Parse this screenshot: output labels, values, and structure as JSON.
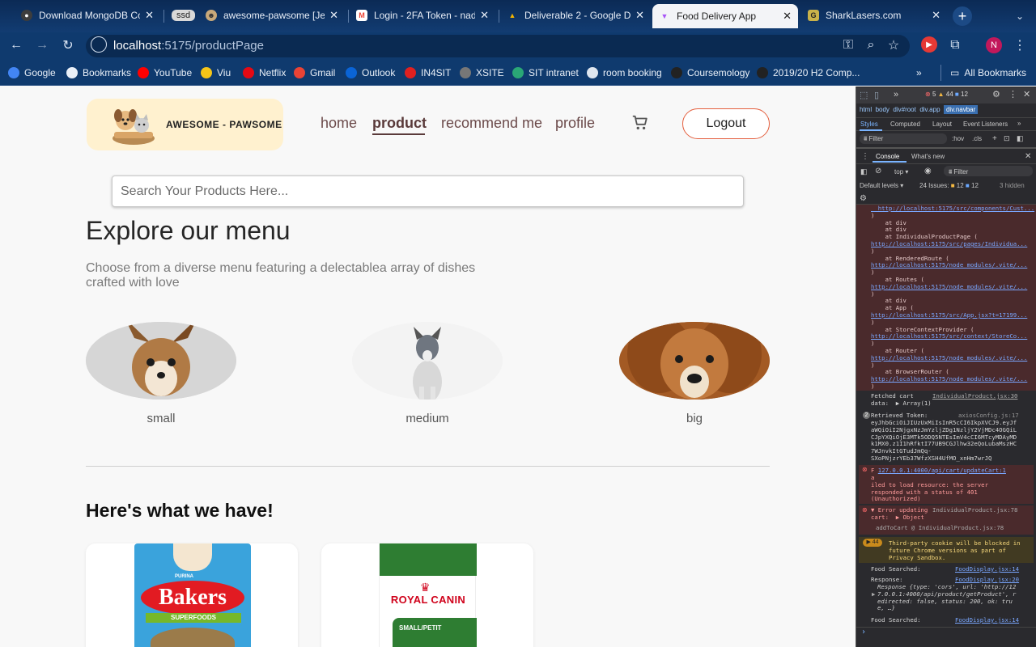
{
  "browser": {
    "tabs": [
      {
        "title": "Download MongoDB Co",
        "icon": "mongodb-icon"
      },
      {
        "title": "ssd",
        "icon": "group-icon"
      },
      {
        "title": "awesome-pawsome [Jer",
        "icon": "github-icon"
      },
      {
        "title": "Login - 2FA Token - nadi",
        "icon": "gmail-icon"
      },
      {
        "title": "Deliverable 2 - Google D",
        "icon": "drive-icon"
      },
      {
        "title": "Food Delivery App",
        "icon": "vite-icon"
      },
      {
        "title": "SharkLasers.com",
        "icon": "sharklasers-icon"
      }
    ],
    "url_host": "localhost",
    "url_path": ":5175/productPage",
    "profile_initial": "N",
    "bookmarks": [
      {
        "label": "Google",
        "icon": "google-icon",
        "color": "#4285f4"
      },
      {
        "label": "Bookmarks",
        "icon": "star-icon",
        "color": "#eaf0f8"
      },
      {
        "label": "YouTube",
        "icon": "youtube-icon",
        "color": "#ff0000"
      },
      {
        "label": "Viu",
        "icon": "viu-icon",
        "color": "#f5c518"
      },
      {
        "label": "Netflix",
        "icon": "netflix-icon",
        "color": "#e50914"
      },
      {
        "label": "Gmail",
        "icon": "gmail-icon",
        "color": "#ea4335"
      },
      {
        "label": "Outlook",
        "icon": "outlook-icon",
        "color": "#0a64d6"
      },
      {
        "label": "IN4SIT",
        "icon": "in4sit-icon",
        "color": "#e02020"
      },
      {
        "label": "XSITE",
        "icon": "xsite-icon",
        "color": "#777777"
      },
      {
        "label": "SIT intranet",
        "icon": "sit-icon",
        "color": "#2aa776"
      },
      {
        "label": "room booking",
        "icon": "doc-icon",
        "color": "#dfe6ef"
      },
      {
        "label": "Coursemology",
        "icon": "coursemology-icon",
        "color": "#222222"
      },
      {
        "label": "2019/20 H2 Comp...",
        "icon": "comp-icon",
        "color": "#222222"
      }
    ],
    "all_bookmarks": "All Bookmarks"
  },
  "app": {
    "logo_text": "AWESOME - PAWSOME",
    "nav": [
      "home",
      "product",
      "recommend me",
      "profile"
    ],
    "active_nav": "product",
    "logout": "Logout",
    "search_placeholder": "Search Your Products Here...",
    "heading": "Explore our menu",
    "subheading": "Choose from a diverse menu featuring a delectablea array of dishes crafted with love",
    "sizes": [
      "small",
      "medium",
      "big"
    ],
    "section_title": "Here's what we have!",
    "products": [
      {
        "brand": "Bakers",
        "maker": "PURINA",
        "tag": "SUPERFOODS"
      },
      {
        "brand": "ROYAL CANIN",
        "tag": "SMALL/PETIT"
      }
    ]
  },
  "devtools": {
    "breadcrumb": [
      "html",
      "body",
      "div#root",
      "div.app",
      "div.navbar"
    ],
    "errors": "5",
    "warnings": "44",
    "info": "12",
    "tabs": [
      "Styles",
      "Computed",
      "Layout",
      "Event Listeners"
    ],
    "filter_placeholder": "Filter",
    "filter_hov": ":hov",
    "filter_cls": ".cls",
    "console_tabs": [
      "Console",
      "What's new"
    ],
    "context": "top",
    "levels": "Default levels",
    "issues": "24 Issues:",
    "issues_a": "12",
    "issues_b": "12",
    "hidden": "3 hidden",
    "stack_lines": [
      {
        "t": "  http://localhost:5175/src/components/Cust...",
        "link": true
      },
      {
        "t": ")",
        "link": false
      },
      {
        "t": "    at div",
        "link": false
      },
      {
        "t": "    at div",
        "link": false
      },
      {
        "t": "    at IndividualProductPage (",
        "link": false
      },
      {
        "t": "http://localhost:5175/src/pages/Individua...",
        "link": true
      },
      {
        "t": ")",
        "link": false
      },
      {
        "t": "    at RenderedRoute (",
        "link": false
      },
      {
        "t": "http://localhost:5175/node_modules/.vite/...",
        "link": true
      },
      {
        "t": ")",
        "link": false
      },
      {
        "t": "    at Routes (",
        "link": false
      },
      {
        "t": "http://localhost:5175/node_modules/.vite/...",
        "link": true
      },
      {
        "t": ")",
        "link": false
      },
      {
        "t": "    at div",
        "link": false
      },
      {
        "t": "    at App (",
        "link": false
      },
      {
        "t": "http://localhost:5175/src/App.jsx?t=17199...",
        "link": true
      },
      {
        "t": ")",
        "link": false
      },
      {
        "t": "    at StoreContextProvider (",
        "link": false
      },
      {
        "t": "http://localhost:5175/src/context/StoreCo...",
        "link": true
      },
      {
        "t": ")",
        "link": false
      },
      {
        "t": "    at Router (",
        "link": false
      },
      {
        "t": "http://localhost:5175/node_modules/.vite/...",
        "link": true
      },
      {
        "t": ")",
        "link": false
      },
      {
        "t": "    at BrowserRouter (",
        "link": false
      },
      {
        "t": "http://localhost:5175/node_modules/.vite/...",
        "link": true
      },
      {
        "t": ")",
        "link": false
      }
    ],
    "log_fetched_label": "Fetched cart",
    "log_fetched_src": "IndividualProduct.jsx:30",
    "log_fetched_data": "data:  ▶ Array(1)",
    "log_token_count": "2",
    "log_token_label": "Retrieved Token:",
    "log_token_src": "axiosConfig.js:17",
    "log_token_value": "eyJhbGciOiJIUzUxMiIsInR5cCI6IkpXVCJ9.eyJf\naWQiOiI2NjgxNzJmYzljZDg1NzljY2VjMDc4OGQiL\nCJpYXQiOjE3MTk5ODQ5NTEsImV4cCI6MTcyMDAyMD\nk1MX0.z1I1hRfktI77UB9CGJlhw32eQoLubaMszHC\n7WJnvkItGTudJmQq-\nSXoPNjzrYEb37WfzXSH4UfMO_xnHm7wrJQ",
    "log_err1_url": "127.0.0.1:4000/api/cart/updateCart:1",
    "log_err1_msg": "a\niled to load resource: the server\nresponded with a status of 401\n(Unauthorized)",
    "log_err2_label": "▼ Error updating",
    "log_err2_src": "IndividualProduct.jsx:78",
    "log_err2_cart": "cart:  ▶ Object",
    "log_err2_fn": "addToCart @ IndividualProduct.jsx:78",
    "log_warn_count": "44",
    "log_warn_msg": "Third-party cookie will be blocked in\nfuture Chrome versions as part of\nPrivacy Sandbox.",
    "log_search1": "Food Searched:",
    "log_search_src": "FoodDisplay.jsx:14",
    "log_response": "Response:",
    "log_response_src": "FoodDisplay.jsx:20",
    "log_response_val": "Response {type: 'cors', url: 'http://12\n7.0.0.1:4000/api/product/getProduct', r\nedirected: false, status: 200, ok: tru\ne, …}",
    "log_search2": "Food Searched:",
    "log_search2_src": "FoodDisplay.jsx:14"
  }
}
